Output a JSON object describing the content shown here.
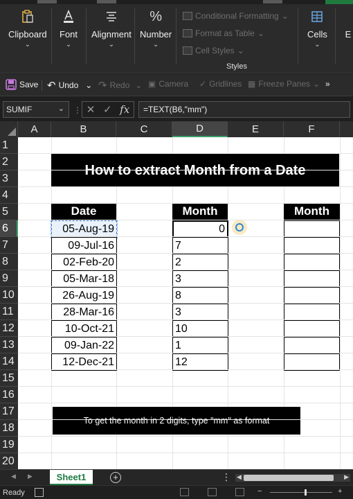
{
  "ribbon": {
    "groups": [
      {
        "label": "Clipboard",
        "icon": "clipboard-icon"
      },
      {
        "label": "Font",
        "icon": "font-color-icon"
      },
      {
        "label": "Alignment",
        "icon": "alignment-icon"
      },
      {
        "label": "Number",
        "icon": "percent-icon"
      }
    ],
    "styles_items": [
      "Conditional Formatting",
      "Format as Table",
      "Cell Styles"
    ],
    "styles_label": "Styles",
    "cells_label": "Cells",
    "editing_label": "E"
  },
  "qat": {
    "save": "Save",
    "undo": "Undo",
    "redo": "Redo",
    "camera": "Camera",
    "gridlines": "Gridlines",
    "freeze": "Freeze Panes",
    "more": "»"
  },
  "formula_bar": {
    "name_box": "SUMIF",
    "cancel": "✕",
    "enter": "✓",
    "fx": "fx",
    "formula": "=TEXT(B6,\"mm\")"
  },
  "sheet": {
    "columns": [
      "A",
      "B",
      "C",
      "D",
      "E",
      "F"
    ],
    "rows": [
      "1",
      "2",
      "3",
      "4",
      "5",
      "6",
      "7",
      "8",
      "9",
      "10",
      "11",
      "12",
      "13",
      "14",
      "15",
      "16",
      "17",
      "18",
      "19",
      "20"
    ],
    "title": "How to extract Month from a Date",
    "headers": {
      "date": "Date",
      "month_d": "Month",
      "month_f": "Month"
    },
    "dates": [
      "05-Aug-19",
      "09-Jul-16",
      "02-Feb-20",
      "05-Mar-18",
      "26-Aug-19",
      "28-Mar-16",
      "10-Oct-21",
      "09-Jan-22",
      "12-Dec-21"
    ],
    "months": [
      "0",
      "7",
      "2",
      "3",
      "8",
      "3",
      "10",
      "1",
      "12"
    ],
    "note": "To get the month in 2 digits, type \"mm\" as format"
  },
  "tabs": {
    "sheet1": "Sheet1",
    "add": "+"
  },
  "status": {
    "ready": "Ready"
  }
}
